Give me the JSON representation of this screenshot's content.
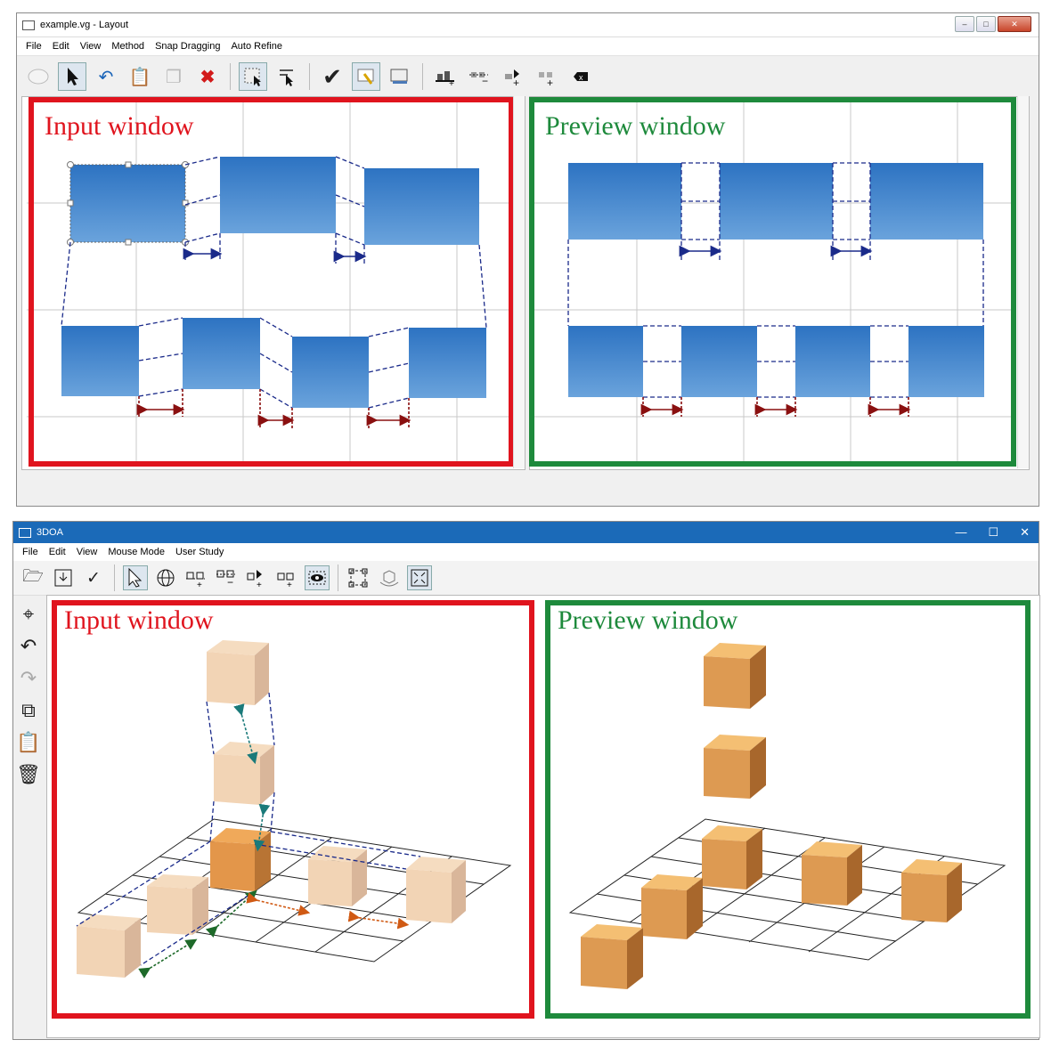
{
  "top_app": {
    "title": "example.vg - Layout",
    "menu": [
      "File",
      "Edit",
      "View",
      "Method",
      "Snap Dragging",
      "Auto Refine"
    ],
    "toolbar_icons": [
      "ellipse-icon",
      "pointer-icon",
      "undo-icon",
      "paste-icon",
      "copy-icon",
      "delete-icon",
      "select-frame-icon",
      "select-list-icon",
      "check-icon",
      "edit-frame-icon",
      "preview-icon",
      "add-align-icon",
      "remove-align-icon",
      "add-gap-icon",
      "remove-gap-icon",
      "erase-icon"
    ],
    "input_label": "Input window",
    "preview_label": "Preview window"
  },
  "bottom_app": {
    "title": "3DOA",
    "menu": [
      "File",
      "Edit",
      "View",
      "Mouse Mode",
      "User Study"
    ],
    "toolbar_icons": [
      "open-folder-icon",
      "save-icon",
      "check-icon",
      "pointer-icon",
      "globe-icon",
      "add-align-icon",
      "remove-align-icon",
      "add-gap-icon",
      "remove-gap-icon",
      "camera-icon",
      "frame-icon",
      "cube-rotate-icon",
      "fit-icon"
    ],
    "sidebar_icons": [
      "pin-icon",
      "undo-icon",
      "redo-icon",
      "copy-icon",
      "paste-icon",
      "trash-icon"
    ],
    "input_label": "Input window",
    "preview_label": "Preview window"
  },
  "colors": {
    "red": "#e0141e",
    "green": "#1e8a3c",
    "blue_box": "#3b7cc4",
    "cube_light": "#efc9a2",
    "cube_dark": "#e39b4e"
  }
}
